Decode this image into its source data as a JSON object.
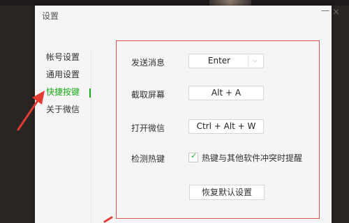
{
  "dialog": {
    "title": "设置"
  },
  "sidebar": {
    "items": [
      {
        "label": "帐号设置",
        "active": false
      },
      {
        "label": "通用设置",
        "active": false
      },
      {
        "label": "快捷按键",
        "active": true
      },
      {
        "label": "关于微信",
        "active": false
      }
    ]
  },
  "shortcuts": {
    "send_message": {
      "label": "发送消息",
      "value": "Enter"
    },
    "screenshot": {
      "label": "截取屏幕",
      "value": "Alt + A"
    },
    "open_wechat": {
      "label": "打开微信",
      "value": "Ctrl + Alt + W"
    },
    "detect_hotkeys": {
      "label": "检测热键",
      "checkbox_label": "热键与其他软件冲突时提醒",
      "checked": true
    },
    "restore_default": "恢复默认设置"
  },
  "colors": {
    "accent": "#1aad19",
    "highlight_border": "#d9534f",
    "annotation_arrow": "#e23b33"
  }
}
